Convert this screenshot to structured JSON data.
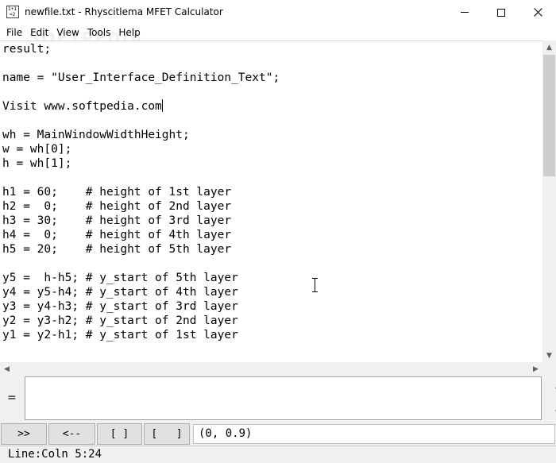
{
  "window": {
    "title": "newfile.txt - Rhyscitlema MFET Calculator",
    "icon_name": "calculator-app-icon",
    "icon_glyphs": [
      "1+1",
      "=2"
    ],
    "controls": [
      "minimize",
      "maximize",
      "close"
    ]
  },
  "menu": {
    "items": [
      "File",
      "Edit",
      "View",
      "Tools",
      "Help"
    ]
  },
  "watermark": "SOFTPEDIA",
  "editor": {
    "lines": [
      "result;",
      "",
      "name = \"User_Interface_Definition_Text\";",
      "",
      "Visit www.softpedia.com",
      "",
      "wh = MainWindowWidthHeight;",
      "w = wh[0];",
      "h = wh[1];",
      "",
      "h1 = 60;    # height of 1st layer",
      "h2 =  0;    # height of 2nd layer",
      "h3 = 30;    # height of 3rd layer",
      "h4 =  0;    # height of 4th layer",
      "h5 = 20;    # height of 5th layer",
      "",
      "y5 =  h-h5; # y_start of 5th layer",
      "y4 = y5-h4; # y_start of 4th layer",
      "y3 = y4-h3; # y_start of 3rd layer",
      "y2 = y3-h2; # y_start of 2nd layer",
      "y1 = y2-h1; # y_start of 1st layer"
    ],
    "caret_line": 4
  },
  "evaluation": {
    "label": "=",
    "input_value": ""
  },
  "toolbar": {
    "buttons": [
      ">>",
      "<--",
      "[ ]",
      "[   ]"
    ],
    "result": "(0, 0.9)"
  },
  "status": {
    "text": "Line:Coln 5:24"
  }
}
